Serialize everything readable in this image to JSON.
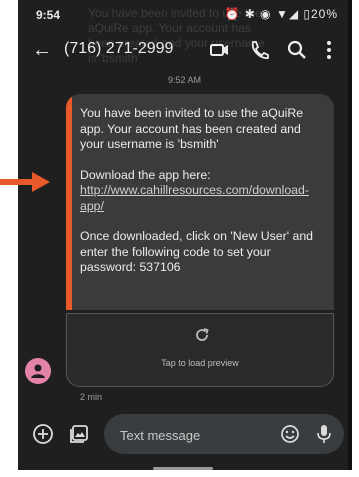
{
  "status": {
    "time": "9:54",
    "icons": "⏰ ✱ ◉ ▼◢ ▯20%",
    "ghost_notification": "You have been invited to use the aQuiRe app. Your account has been created and your username is 'bsmith'"
  },
  "appbar": {
    "back": "←",
    "title": "(716) 271-2999"
  },
  "conversation": {
    "timestamp": "9:52 AM",
    "message": {
      "p1": "You have been invited to use the aQuiRe app. Your account has been created and your username is 'bsmith'",
      "p2_prefix": "Download the app here: ",
      "p2_link": "http://www.cahillresources.com/download-app/",
      "p3": "Once downloaded, click on 'New User' and enter the following code to set your password: 537106"
    },
    "preview_label": "Tap to load preview",
    "message_age": "2 min"
  },
  "composer": {
    "placeholder": "Text message"
  },
  "colors": {
    "accent": "#e85a2a",
    "avatar": "#e383a8",
    "background": "#1f1f1f"
  }
}
